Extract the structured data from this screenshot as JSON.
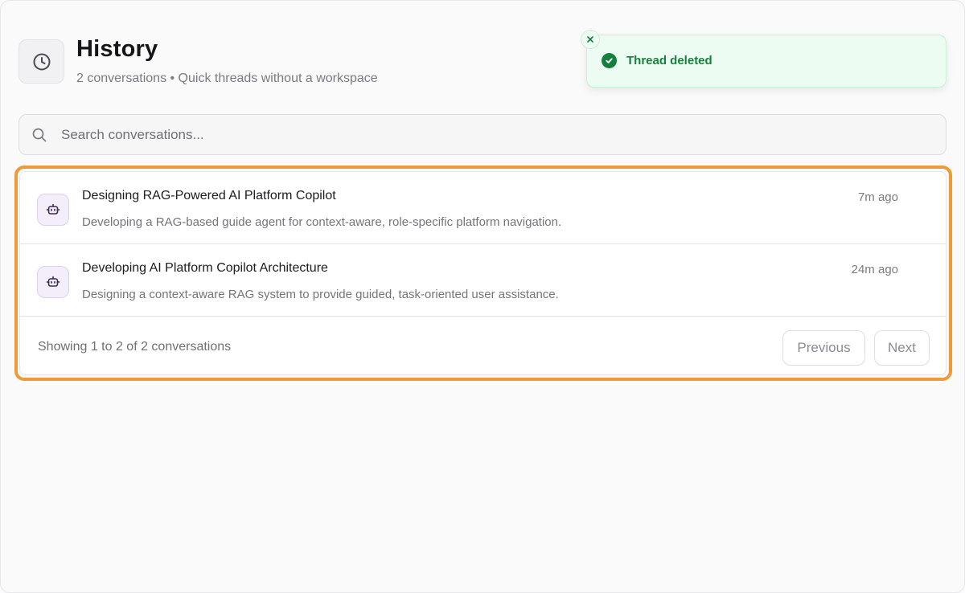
{
  "header": {
    "icon": "clock-icon",
    "title": "History",
    "subtitle": "2 conversations • Quick threads without a workspace"
  },
  "toast": {
    "message": "Thread deleted",
    "close_icon": "close-icon",
    "status_icon": "check-circle-icon",
    "color": "#15803d",
    "background": "#edfcf2"
  },
  "search": {
    "icon": "search-icon",
    "placeholder": "Search conversations...",
    "value": ""
  },
  "conversations": [
    {
      "icon": "bot-icon",
      "title": "Designing RAG-Powered AI Platform Copilot",
      "description": "Developing a RAG-based guide agent for context-aware, role-specific platform navigation.",
      "time": "7m ago"
    },
    {
      "icon": "bot-icon",
      "title": "Developing AI Platform Copilot Architecture",
      "description": "Designing a context-aware RAG system to provide guided, task-oriented user assistance.",
      "time": "24m ago"
    }
  ],
  "pagination": {
    "summary": "Showing 1 to 2 of 2 conversations",
    "previous_label": "Previous",
    "next_label": "Next"
  },
  "colors": {
    "highlight": "#ee9a3a",
    "accent_icon": "#5b3d7a"
  }
}
